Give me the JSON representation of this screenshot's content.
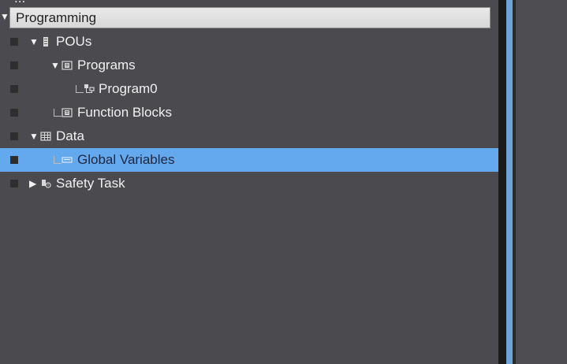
{
  "panel": {
    "top_cut_text": "...",
    "section_title": "Programming"
  },
  "tree": {
    "items": [
      {
        "label": "POUs"
      },
      {
        "label": "Programs"
      },
      {
        "label": "Program0"
      },
      {
        "label": "Function Blocks"
      },
      {
        "label": "Data"
      },
      {
        "label": "Global Variables"
      },
      {
        "label": "Safety Task"
      }
    ]
  },
  "colors": {
    "background": "#4a4a4f",
    "selected": "#64a8ee",
    "section_header": "#e2e2e2",
    "divider_blue": "#6ea5d9"
  },
  "icons": {
    "section_expand": "triangle-down-icon",
    "pous": "pous-icon",
    "programs": "programs-folder-icon",
    "program": "program-icon",
    "function_blocks": "function-blocks-icon",
    "data": "data-table-icon",
    "global_variables": "global-variables-icon",
    "safety_task": "safety-task-icon"
  }
}
